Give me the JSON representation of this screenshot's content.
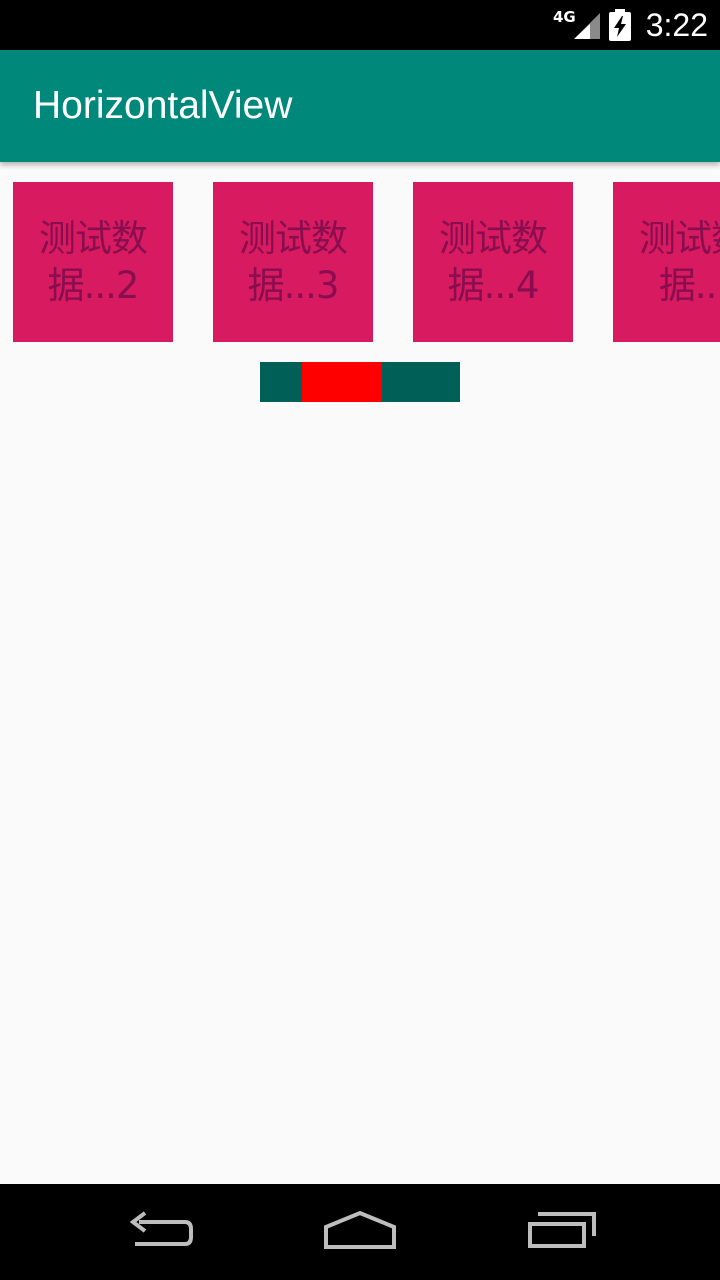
{
  "status_bar": {
    "network_type": "4G",
    "time": "3:22",
    "icons": [
      "signal-icon",
      "battery-charging-icon"
    ]
  },
  "app_bar": {
    "title": "HorizontalView",
    "background": "#00897b"
  },
  "cards": {
    "background": "#d81b60",
    "text_color": "#880e4f",
    "items": [
      {
        "label": "测试数据...2"
      },
      {
        "label": "测试数据...3"
      },
      {
        "label": "测试数据...4"
      },
      {
        "label": "测试数据..."
      }
    ]
  },
  "scroll_indicator": {
    "track_color": "#005f56",
    "thumb_color": "#ff0000",
    "thumb_start_fraction": 0.21,
    "thumb_end_fraction": 0.61
  },
  "nav_bar": {
    "icons": [
      "back-icon",
      "home-icon",
      "recents-icon"
    ]
  }
}
